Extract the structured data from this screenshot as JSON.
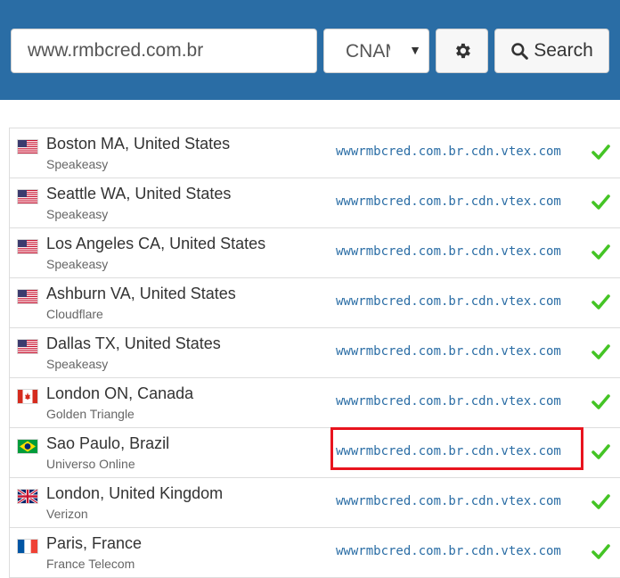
{
  "search": {
    "domain_value": "www.rmbcred.com.br",
    "record_type": "CNAME",
    "settings_icon": "gear-icon",
    "search_icon": "magnifier-icon",
    "search_label": "Search"
  },
  "results": [
    {
      "flag": "us",
      "location": "Boston MA, United States",
      "provider": "Speakeasy",
      "value": "wwwrmbcred.com.br.cdn.vtex.com",
      "status": "ok"
    },
    {
      "flag": "us",
      "location": "Seattle WA, United States",
      "provider": "Speakeasy",
      "value": "wwwrmbcred.com.br.cdn.vtex.com",
      "status": "ok"
    },
    {
      "flag": "us",
      "location": "Los Angeles CA, United States",
      "provider": "Speakeasy",
      "value": "wwwrmbcred.com.br.cdn.vtex.com",
      "status": "ok"
    },
    {
      "flag": "us",
      "location": "Ashburn VA, United States",
      "provider": "Cloudflare",
      "value": "wwwrmbcred.com.br.cdn.vtex.com",
      "status": "ok"
    },
    {
      "flag": "us",
      "location": "Dallas TX, United States",
      "provider": "Speakeasy",
      "value": "wwwrmbcred.com.br.cdn.vtex.com",
      "status": "ok"
    },
    {
      "flag": "ca",
      "location": "London ON, Canada",
      "provider": "Golden Triangle",
      "value": "wwwrmbcred.com.br.cdn.vtex.com",
      "status": "ok"
    },
    {
      "flag": "br",
      "location": "Sao Paulo, Brazil",
      "provider": "Universo Online",
      "value": "wwwrmbcred.com.br.cdn.vtex.com",
      "status": "ok"
    },
    {
      "flag": "gb",
      "location": "London, United Kingdom",
      "provider": "Verizon",
      "value": "wwwrmbcred.com.br.cdn.vtex.com",
      "status": "ok"
    },
    {
      "flag": "fr",
      "location": "Paris, France",
      "provider": "France Telecom",
      "value": "wwwrmbcred.com.br.cdn.vtex.com",
      "status": "ok"
    }
  ],
  "colors": {
    "header_bg": "#2a6da5",
    "result_text": "#2a6da5",
    "check": "#44c425",
    "highlight": "#e8141e"
  }
}
